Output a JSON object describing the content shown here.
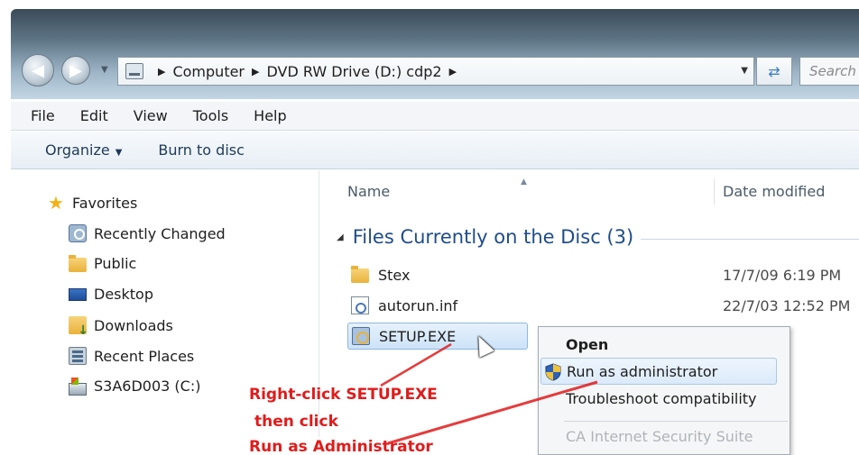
{
  "address_bar": {
    "path": [
      "Computer",
      "DVD RW Drive (D:) cdp2"
    ],
    "drive_icon": "drive-icon"
  },
  "search": {
    "placeholder": "Search"
  },
  "menu": [
    "File",
    "Edit",
    "View",
    "Tools",
    "Help"
  ],
  "toolbar": {
    "organize": "Organize",
    "burn": "Burn to disc"
  },
  "nav_pane": {
    "favorites": "Favorites",
    "items": [
      {
        "label": "Recently Changed",
        "icon": "recent-icon"
      },
      {
        "label": "Public",
        "icon": "folder-icon"
      },
      {
        "label": "Desktop",
        "icon": "desktop-icon"
      },
      {
        "label": "Downloads",
        "icon": "downloads-icon"
      },
      {
        "label": "Recent Places",
        "icon": "recent-places-icon"
      },
      {
        "label": "S3A6D003 (C:)",
        "icon": "drive-icon"
      }
    ]
  },
  "content": {
    "columns": {
      "name": "Name",
      "date": "Date modified"
    },
    "group": "Files Currently on the Disc (3)",
    "files": [
      {
        "name": "Stex",
        "date": "17/7/09 6:19 PM",
        "icon": "folder-icon"
      },
      {
        "name": "autorun.inf",
        "date": "22/7/03 12:52 PM",
        "icon": "inf-file-icon"
      },
      {
        "name": "SETUP.EXE",
        "date": "",
        "icon": "exe-icon"
      }
    ]
  },
  "context_menu": {
    "open": "Open",
    "run_as_admin": "Run as administrator",
    "troubleshoot": "Troubleshoot compatibility",
    "next_partial": "CA Internet Security Suite"
  },
  "annotation": {
    "line1": "Right-click SETUP.EXE",
    "line2": "then click",
    "line3": "Run as Administrator",
    "color": "#e11b1b"
  }
}
